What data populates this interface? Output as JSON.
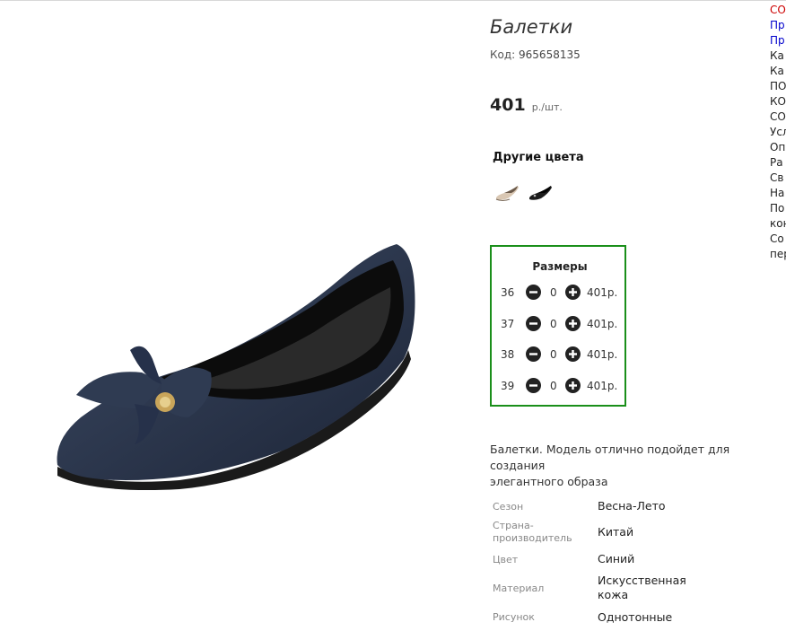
{
  "product": {
    "title": "Балетки",
    "sku_label": "Код:",
    "sku": "965658135",
    "price": "401",
    "price_unit": "р./шт.",
    "other_colors_heading": "Другие цвета",
    "color_swatches": [
      "beige-flat-icon",
      "black-flat-icon"
    ],
    "sizes_heading": "Размеры",
    "sizes": [
      {
        "size": "36",
        "qty": "0",
        "price": "401р."
      },
      {
        "size": "37",
        "qty": "0",
        "price": "401р."
      },
      {
        "size": "38",
        "qty": "0",
        "price": "401р."
      },
      {
        "size": "39",
        "qty": "0",
        "price": "401р."
      }
    ],
    "description_line1": "Балетки. Модель отлично подойдет для создания",
    "description_line2": "элегантного образа",
    "specs": [
      {
        "key": "Сезон",
        "value": "Весна-Лето"
      },
      {
        "key_line1": "Страна-",
        "key_line2": "производитель",
        "value": "Китай"
      },
      {
        "key": "Цвет",
        "value": "Синий"
      },
      {
        "key": "Материал",
        "value_line1": "Искусственная",
        "value_line2": "кожа"
      },
      {
        "key": "Рисунок",
        "value": "Однотонные"
      }
    ]
  },
  "sidebar": {
    "items": [
      "СО",
      "Пр",
      "Пр",
      "Ка",
      "Ка",
      "ПО",
      "КО",
      "СО",
      "Усл",
      "Оп",
      "Ра",
      "Св",
      "На",
      "По",
      "кон",
      "Со",
      "пер"
    ]
  },
  "colors": {
    "accent_border": "#1a8f1a",
    "sidebar_red": "#cc0000",
    "sidebar_link": "#0000cc"
  }
}
